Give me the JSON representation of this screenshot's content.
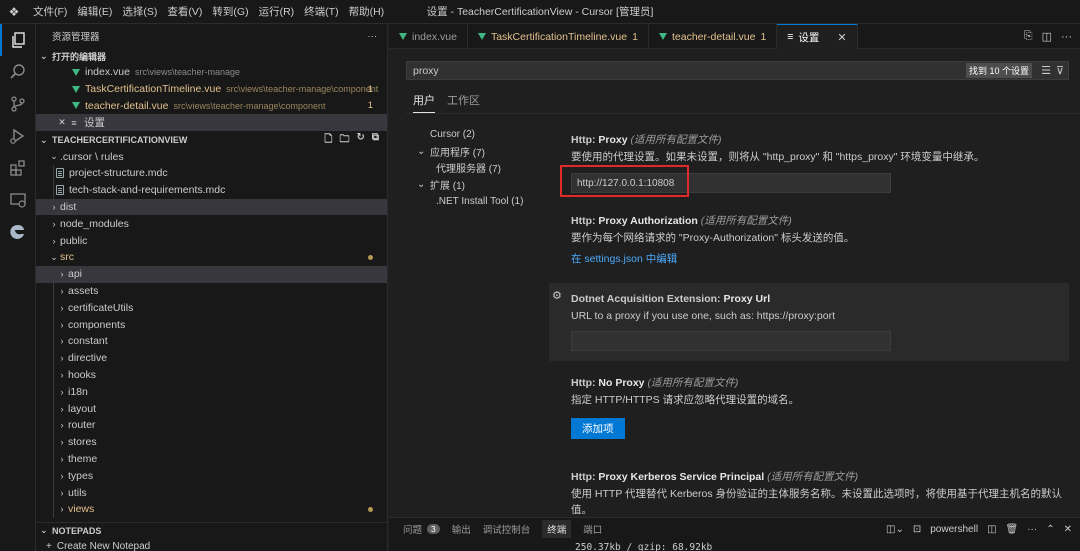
{
  "titlebar": {
    "menu": [
      "文件(F)",
      "编辑(E)",
      "选择(S)",
      "查看(V)",
      "转到(G)",
      "运行(R)",
      "终端(T)",
      "帮助(H)"
    ],
    "title": "设置 - TeacherCertificationView - Cursor [管理员]"
  },
  "activity_icons": [
    "explorer-icon",
    "search-icon",
    "source-control-icon",
    "run-debug-icon",
    "extensions-icon",
    "remote-explorer-icon",
    "edge-icon"
  ],
  "sidebar": {
    "title": "资源管理器",
    "more": "···",
    "open_editors": {
      "label": "打开的编辑器",
      "items": [
        {
          "name": "index.vue",
          "path": "src\\views\\teacher-manage",
          "count": ""
        },
        {
          "name": "TaskCertificationTimeline.vue",
          "path": "src\\views\\teacher-manage\\component",
          "count": "1"
        },
        {
          "name": "teacher-detail.vue",
          "path": "src\\views\\teacher-manage\\component",
          "count": "1"
        },
        {
          "name": "设置",
          "path": "",
          "count": ""
        }
      ]
    },
    "project": {
      "label": "TEACHERCERTIFICATIONVIEW",
      "tree": [
        {
          "name": ".cursor \\ rules",
          "depth": 0,
          "type": "folder-open"
        },
        {
          "name": "project-structure.mdc",
          "depth": 1,
          "type": "file"
        },
        {
          "name": "tech-stack-and-requirements.mdc",
          "depth": 1,
          "type": "file"
        },
        {
          "name": "dist",
          "depth": 0,
          "type": "folder"
        },
        {
          "name": "node_modules",
          "depth": 0,
          "type": "folder"
        },
        {
          "name": "public",
          "depth": 0,
          "type": "folder"
        },
        {
          "name": "src",
          "depth": 0,
          "type": "folder-open"
        },
        {
          "name": "api",
          "depth": 1,
          "type": "folder"
        },
        {
          "name": "assets",
          "depth": 1,
          "type": "folder"
        },
        {
          "name": "certificateUtils",
          "depth": 1,
          "type": "folder"
        },
        {
          "name": "components",
          "depth": 1,
          "type": "folder"
        },
        {
          "name": "constant",
          "depth": 1,
          "type": "folder"
        },
        {
          "name": "directive",
          "depth": 1,
          "type": "folder"
        },
        {
          "name": "hooks",
          "depth": 1,
          "type": "folder"
        },
        {
          "name": "i18n",
          "depth": 1,
          "type": "folder"
        },
        {
          "name": "layout",
          "depth": 1,
          "type": "folder"
        },
        {
          "name": "router",
          "depth": 1,
          "type": "folder"
        },
        {
          "name": "stores",
          "depth": 1,
          "type": "folder"
        },
        {
          "name": "theme",
          "depth": 1,
          "type": "folder"
        },
        {
          "name": "types",
          "depth": 1,
          "type": "folder"
        },
        {
          "name": "utils",
          "depth": 1,
          "type": "folder"
        },
        {
          "name": "views",
          "depth": 1,
          "type": "folder"
        }
      ]
    },
    "notepads": {
      "label": "NOTEPADS",
      "create": "Create New Notepad"
    }
  },
  "tabs": [
    {
      "label": "index.vue",
      "count": "",
      "modified": false
    },
    {
      "label": "TaskCertificationTimeline.vue",
      "count": "1",
      "modified": true
    },
    {
      "label": "teacher-detail.vue",
      "count": "1",
      "modified": true
    },
    {
      "label": "设置",
      "count": "",
      "modified": false
    }
  ],
  "settings": {
    "search_value": "proxy",
    "found": "找到 10 个设置",
    "scope_tabs": [
      "用户",
      "工作区"
    ],
    "toc": [
      {
        "label": "Cursor (2)",
        "chev": ""
      },
      {
        "label": "应用程序 (7)",
        "chev": "⌄"
      },
      {
        "label": "代理服务器 (7)",
        "chev": ""
      },
      {
        "label": "扩展 (1)",
        "chev": "⌄"
      },
      {
        "label": ".NET Install Tool (1)",
        "chev": ""
      }
    ],
    "items": {
      "proxy": {
        "category": "Http: ",
        "name": "Proxy",
        "scope": "(适用所有配置文件)",
        "desc": "要使用的代理设置。如果未设置，则将从 \"http_proxy\" 和 \"https_proxy\" 环境变量中继承。",
        "value": "http://127.0.0.1:10808"
      },
      "proxy_auth": {
        "category": "Http: ",
        "name": "Proxy Authorization",
        "scope": "(适用所有配置文件)",
        "desc": "要作为每个网络请求的 \"Proxy-Authorization\" 标头发送的值。",
        "link": "在 settings.json 中编辑"
      },
      "dotnet_proxy": {
        "category": "Dotnet Acquisition Extension: ",
        "name": "Proxy Url",
        "desc": "URL to a proxy if you use one, such as: https://proxy:port"
      },
      "no_proxy": {
        "category": "Http: ",
        "name": "No Proxy",
        "scope": "(适用所有配置文件)",
        "desc": "指定 HTTP/HTTPS 请求应忽略代理设置的域名。",
        "button": "添加项"
      },
      "kerberos": {
        "category": "Http: ",
        "name": "Proxy Kerberos Service Principal",
        "scope": "(适用所有配置文件)",
        "desc": "使用 HTTP 代理替代 Kerberos 身份验证的主体服务名称。未设置此选项时，将使用基于代理主机名的默认值。"
      }
    }
  },
  "panel": {
    "tabs": [
      "问题",
      "输出",
      "调试控制台",
      "终端",
      "端口"
    ],
    "problems_count": "3",
    "terminal_name": "powershell",
    "terminal_text": "250.37kb / gzip: 68.92kb"
  },
  "colors": {
    "accent": "#0078d4",
    "modified": "#e2c08d",
    "highlight": "#e02a2a",
    "vue": "#41b883"
  }
}
